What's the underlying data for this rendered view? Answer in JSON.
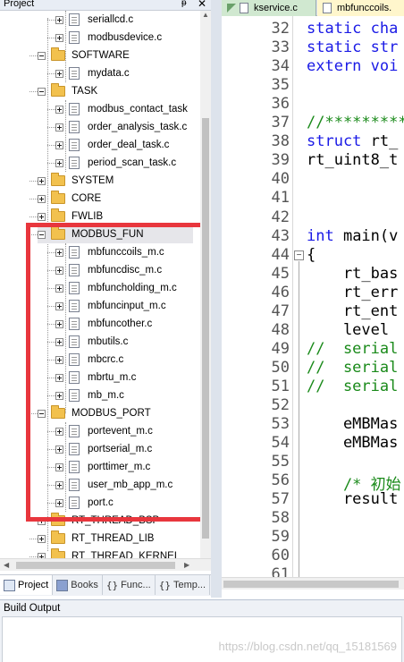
{
  "project_panel": {
    "title": "Project",
    "pin_glyph": "ᵽ",
    "close_glyph": "✕"
  },
  "tree": [
    {
      "level": 2,
      "kind": "file",
      "label": "seriallcd.c"
    },
    {
      "level": 2,
      "kind": "file",
      "label": "modbusdevice.c"
    },
    {
      "level": 1,
      "kind": "folder",
      "label": "SOFTWARE",
      "expanded": true
    },
    {
      "level": 2,
      "kind": "file",
      "label": "mydata.c"
    },
    {
      "level": 1,
      "kind": "folder",
      "label": "TASK",
      "expanded": true
    },
    {
      "level": 2,
      "kind": "file",
      "label": "modbus_contact_task"
    },
    {
      "level": 2,
      "kind": "file",
      "label": "order_analysis_task.c"
    },
    {
      "level": 2,
      "kind": "file",
      "label": "order_deal_task.c"
    },
    {
      "level": 2,
      "kind": "file",
      "label": "period_scan_task.c"
    },
    {
      "level": 1,
      "kind": "folder",
      "label": "SYSTEM",
      "expanded": false
    },
    {
      "level": 1,
      "kind": "folder",
      "label": "CORE",
      "expanded": false
    },
    {
      "level": 1,
      "kind": "folder",
      "label": "FWLIB",
      "expanded": false
    },
    {
      "level": 1,
      "kind": "folder",
      "label": "MODBUS_FUN",
      "expanded": true,
      "selected": true
    },
    {
      "level": 2,
      "kind": "file",
      "label": "mbfunccoils_m.c"
    },
    {
      "level": 2,
      "kind": "file",
      "label": "mbfuncdisc_m.c"
    },
    {
      "level": 2,
      "kind": "file",
      "label": "mbfuncholding_m.c"
    },
    {
      "level": 2,
      "kind": "file",
      "label": "mbfuncinput_m.c"
    },
    {
      "level": 2,
      "kind": "file",
      "label": "mbfuncother.c"
    },
    {
      "level": 2,
      "kind": "file",
      "label": "mbutils.c"
    },
    {
      "level": 2,
      "kind": "file",
      "label": "mbcrc.c"
    },
    {
      "level": 2,
      "kind": "file",
      "label": "mbrtu_m.c"
    },
    {
      "level": 2,
      "kind": "file",
      "label": "mb_m.c"
    },
    {
      "level": 1,
      "kind": "folder",
      "label": "MODBUS_PORT",
      "expanded": true
    },
    {
      "level": 2,
      "kind": "file",
      "label": "portevent_m.c"
    },
    {
      "level": 2,
      "kind": "file",
      "label": "portserial_m.c"
    },
    {
      "level": 2,
      "kind": "file",
      "label": "porttimer_m.c"
    },
    {
      "level": 2,
      "kind": "file",
      "label": "user_mb_app_m.c"
    },
    {
      "level": 2,
      "kind": "file",
      "label": "port.c"
    },
    {
      "level": 1,
      "kind": "folder",
      "label": "RT_THREAD_BSP",
      "expanded": false
    },
    {
      "level": 1,
      "kind": "folder",
      "label": "RT_THREAD_LIB",
      "expanded": false
    },
    {
      "level": 1,
      "kind": "folder",
      "label": "RT_THREAD_KERNEL",
      "expanded": false
    }
  ],
  "bottom_tabs": [
    {
      "label": "Project",
      "active": true
    },
    {
      "label": "Books",
      "active": false
    },
    {
      "label": "Func...",
      "active": false
    },
    {
      "label": "Temp...",
      "active": false
    }
  ],
  "editor_tabs": [
    {
      "label": "kservice.c"
    },
    {
      "label": "mbfunccoils."
    }
  ],
  "code_lines": [
    {
      "n": "32",
      "segments": [
        {
          "t": "static cha",
          "c": "kw"
        }
      ]
    },
    {
      "n": "33",
      "segments": [
        {
          "t": "static str",
          "c": "kw"
        }
      ]
    },
    {
      "n": "34",
      "segments": [
        {
          "t": "extern voi",
          "c": "kw"
        }
      ]
    },
    {
      "n": "35",
      "segments": []
    },
    {
      "n": "36",
      "segments": []
    },
    {
      "n": "37",
      "segments": [
        {
          "t": "//*********",
          "c": "cm"
        }
      ]
    },
    {
      "n": "38",
      "segments": [
        {
          "t": "struct ",
          "c": "kw"
        },
        {
          "t": "rt_",
          "c": ""
        }
      ]
    },
    {
      "n": "39",
      "segments": [
        {
          "t": "rt_uint8_t",
          "c": ""
        }
      ]
    },
    {
      "n": "40",
      "segments": []
    },
    {
      "n": "41",
      "segments": []
    },
    {
      "n": "42",
      "segments": []
    },
    {
      "n": "43",
      "segments": [
        {
          "t": "int ",
          "c": "kw"
        },
        {
          "t": "main(v",
          "c": ""
        }
      ]
    },
    {
      "n": "44",
      "segments": [
        {
          "t": "{",
          "c": ""
        }
      ],
      "fold": "-"
    },
    {
      "n": "45",
      "segments": [
        {
          "t": "    rt_bas",
          "c": ""
        }
      ]
    },
    {
      "n": "46",
      "segments": [
        {
          "t": "    rt_err",
          "c": ""
        }
      ]
    },
    {
      "n": "47",
      "segments": [
        {
          "t": "    rt_ent",
          "c": ""
        }
      ]
    },
    {
      "n": "48",
      "segments": [
        {
          "t": "    level",
          "c": ""
        }
      ]
    },
    {
      "n": "49",
      "segments": [
        {
          "t": "//  serial",
          "c": "cm"
        }
      ]
    },
    {
      "n": "50",
      "segments": [
        {
          "t": "//  serial",
          "c": "cm"
        }
      ]
    },
    {
      "n": "51",
      "segments": [
        {
          "t": "//  serial",
          "c": "cm"
        }
      ]
    },
    {
      "n": "52",
      "segments": []
    },
    {
      "n": "53",
      "segments": [
        {
          "t": "    eMBMas",
          "c": ""
        }
      ]
    },
    {
      "n": "54",
      "segments": [
        {
          "t": "    eMBMas",
          "c": ""
        }
      ]
    },
    {
      "n": "55",
      "segments": []
    },
    {
      "n": "56",
      "segments": [
        {
          "t": "    /* 初始",
          "c": "cm"
        }
      ]
    },
    {
      "n": "57",
      "segments": [
        {
          "t": "    result",
          "c": ""
        }
      ]
    },
    {
      "n": "58",
      "segments": []
    },
    {
      "n": "59",
      "segments": []
    },
    {
      "n": "60",
      "segments": []
    },
    {
      "n": "61",
      "segments": []
    }
  ],
  "build_output": {
    "title": "Build Output",
    "watermark": "https://blog.csdn.net/qq_15181569"
  },
  "colors": {
    "highlight": "#e8363d",
    "keyword": "#1a1ae6",
    "comment": "#1a8a1a",
    "folder": "#f2c14e"
  }
}
